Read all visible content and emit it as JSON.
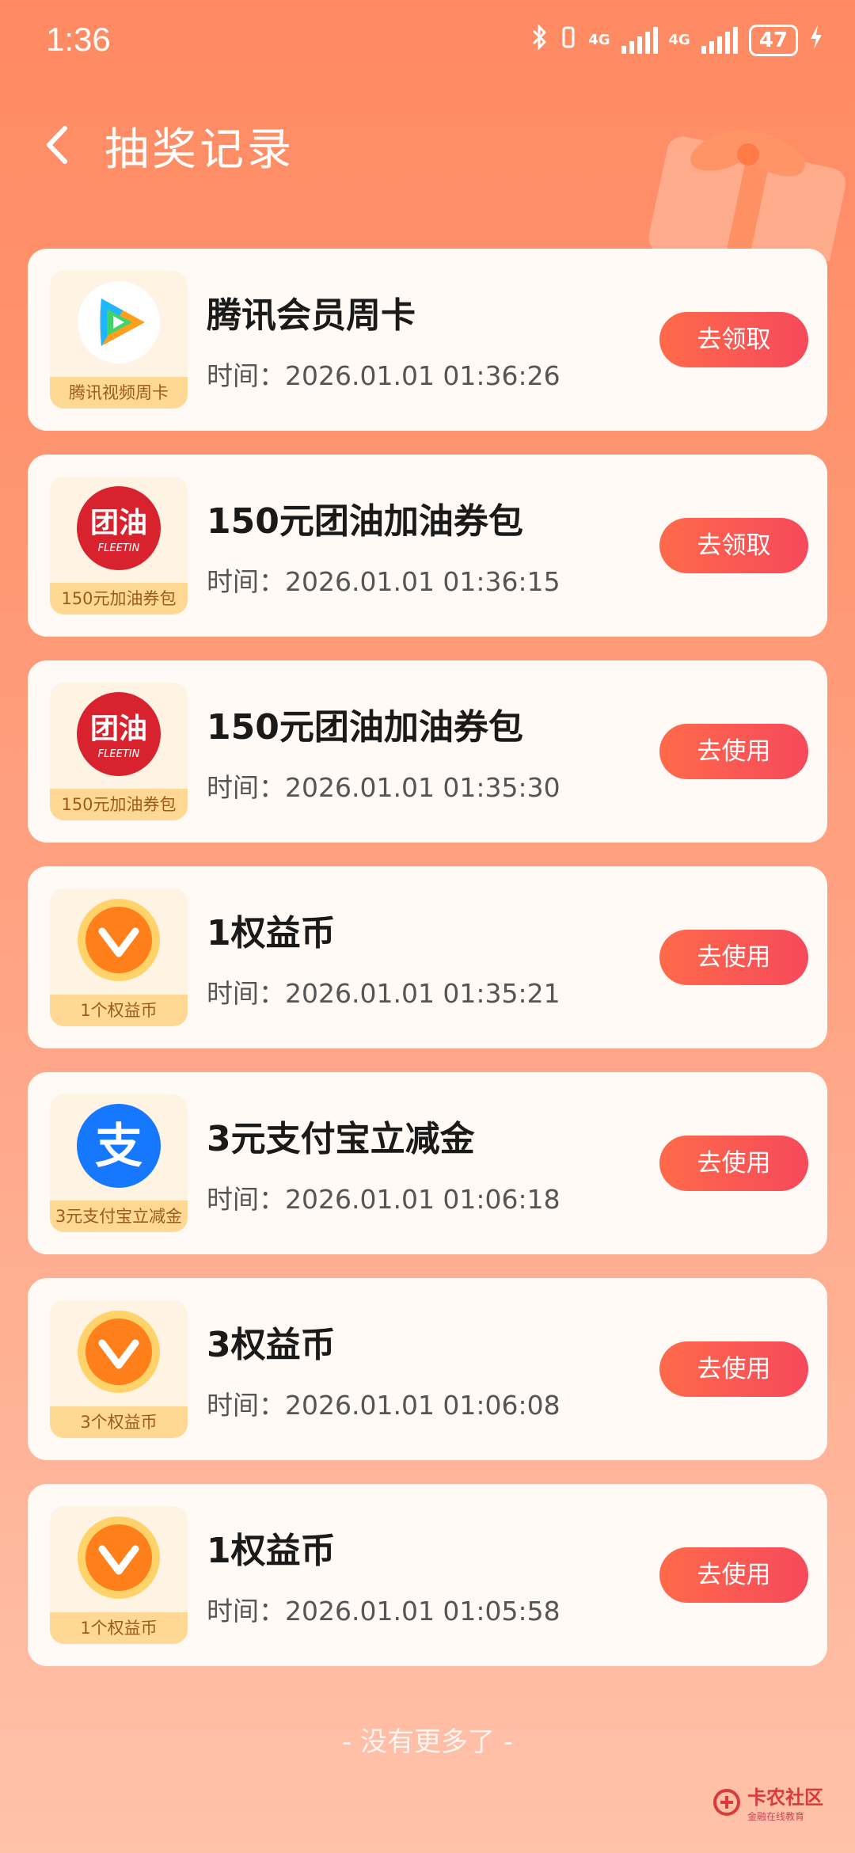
{
  "status": {
    "time": "1:36",
    "network1": "4G",
    "network2": "4G",
    "battery": "47"
  },
  "header": {
    "title": "抽奖记录"
  },
  "items": [
    {
      "title": "腾讯会员周卡",
      "time": "时间：2026.01.01 01:36:26",
      "action": "去领取",
      "caption": "腾讯视频周卡",
      "icon": "tencent-video-icon"
    },
    {
      "title": "150元团油加油券包",
      "time": "时间：2026.01.01 01:36:15",
      "action": "去领取",
      "caption": "150元加油券包",
      "icon": "fleetin-icon",
      "logo_text": "团油",
      "logo_sub": "FLEETIN"
    },
    {
      "title": "150元团油加油券包",
      "time": "时间：2026.01.01 01:35:30",
      "action": "去使用",
      "caption": "150元加油券包",
      "icon": "fleetin-icon",
      "logo_text": "团油",
      "logo_sub": "FLEETIN"
    },
    {
      "title": "1权益币",
      "time": "时间：2026.01.01 01:35:21",
      "action": "去使用",
      "caption": "1个权益币",
      "icon": "coin-icon"
    },
    {
      "title": "3元支付宝立减金",
      "time": "时间：2026.01.01 01:06:18",
      "action": "去使用",
      "caption": "3元支付宝立减金",
      "icon": "alipay-icon",
      "logo_text": "支"
    },
    {
      "title": "3权益币",
      "time": "时间：2026.01.01 01:06:08",
      "action": "去使用",
      "caption": "3个权益币",
      "icon": "coin-icon"
    },
    {
      "title": "1权益币",
      "time": "时间：2026.01.01 01:05:58",
      "action": "去使用",
      "caption": "1个权益币",
      "icon": "coin-icon"
    }
  ],
  "footer": {
    "text": "- 没有更多了 -"
  },
  "watermark": {
    "title": "卡农社区",
    "subtitle": "金融在线教育"
  },
  "colors": {
    "accent": "#f5495b",
    "background_top": "#ff8a62",
    "card": "#fffaf6"
  }
}
